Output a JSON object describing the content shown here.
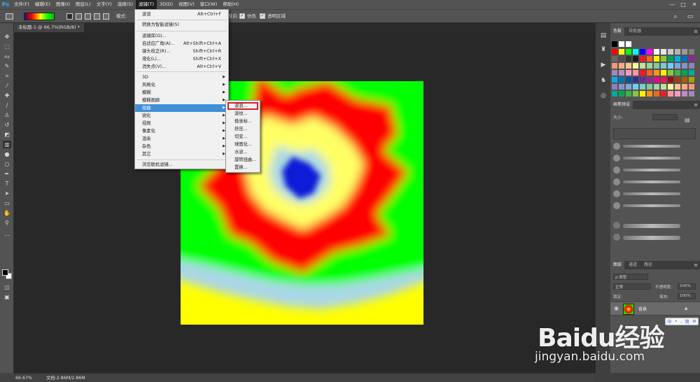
{
  "app": {
    "logo": "Ps"
  },
  "menubar": {
    "items": [
      "文件(F)",
      "编辑(E)",
      "图像(I)",
      "图层(L)",
      "文字(Y)",
      "选择(S)",
      "滤镜(T)",
      "3D(D)",
      "视图(V)",
      "窗口(W)",
      "帮助(H)"
    ],
    "active_index": 6
  },
  "window_controls": {
    "minimize": "—",
    "maximize": "□",
    "close": "✕"
  },
  "options_bar": {
    "mode_label": "模式:",
    "reverse_label": "反向",
    "dither_label": "仿色",
    "transparency_label": "透明区域"
  },
  "document": {
    "tab_title": "未标题-1 @ 66.7%(RGB/8) *"
  },
  "filter_menu": {
    "items": [
      {
        "label": "波浪",
        "shortcut": "Alt+Ctrl+F"
      },
      {
        "label": "转换为智能滤镜(S)",
        "shortcut": ""
      },
      {
        "label": "滤镜库(G)...",
        "shortcut": ""
      },
      {
        "label": "自适应广角(A)...",
        "shortcut": "Alt+Shift+Ctrl+A"
      },
      {
        "label": "镜头校正(R)...",
        "shortcut": "Shift+Ctrl+R"
      },
      {
        "label": "液化(L)...",
        "shortcut": "Shift+Ctrl+X"
      },
      {
        "label": "消失点(V)...",
        "shortcut": "Alt+Ctrl+V"
      },
      {
        "label": "3D",
        "submenu": true
      },
      {
        "label": "风格化",
        "submenu": true
      },
      {
        "label": "模糊",
        "submenu": true
      },
      {
        "label": "模糊画廊",
        "submenu": true
      },
      {
        "label": "扭曲",
        "submenu": true
      },
      {
        "label": "锐化",
        "submenu": true
      },
      {
        "label": "视频",
        "submenu": true
      },
      {
        "label": "像素化",
        "submenu": true
      },
      {
        "label": "渲染",
        "submenu": true
      },
      {
        "label": "杂色",
        "submenu": true
      },
      {
        "label": "其它",
        "submenu": true
      },
      {
        "label": "浏览联机滤镜...",
        "shortcut": ""
      }
    ],
    "highlighted_index": 11
  },
  "distort_submenu": {
    "items": [
      "波浪...",
      "波纹...",
      "极坐标...",
      "挤压...",
      "切变...",
      "球面化...",
      "水波...",
      "旋转扭曲...",
      "置换..."
    ]
  },
  "panels": {
    "swatches_tabs": [
      "色板",
      "导航器"
    ],
    "brushes_tab": "画笔预设",
    "brush_size_label": "大小:",
    "layers_tabs": [
      "图层",
      "通道",
      "路径"
    ],
    "kind_label": "ρ 类型",
    "blend_mode": "正常",
    "opacity_label": "不透明度:",
    "opacity_value": "100%",
    "lock_label": "锁定:",
    "fill_label": "填充:",
    "fill_value": "100%",
    "layer_name": "背景"
  },
  "statusbar": {
    "zoom": "66.67%",
    "doc_info": "文档:2.86M/2.86M"
  },
  "watermark": {
    "logo": "Baidu经验",
    "url": "jingyan.baidu.com"
  },
  "ime": {
    "items": [
      "中",
      "•",
      ",",
      "简",
      "⚙"
    ]
  },
  "colors": {
    "menu_bg": "#535353",
    "workspace_bg": "#282828",
    "menu_highlight": "#3f8fd6",
    "annotation_red": "#d91f2e"
  }
}
